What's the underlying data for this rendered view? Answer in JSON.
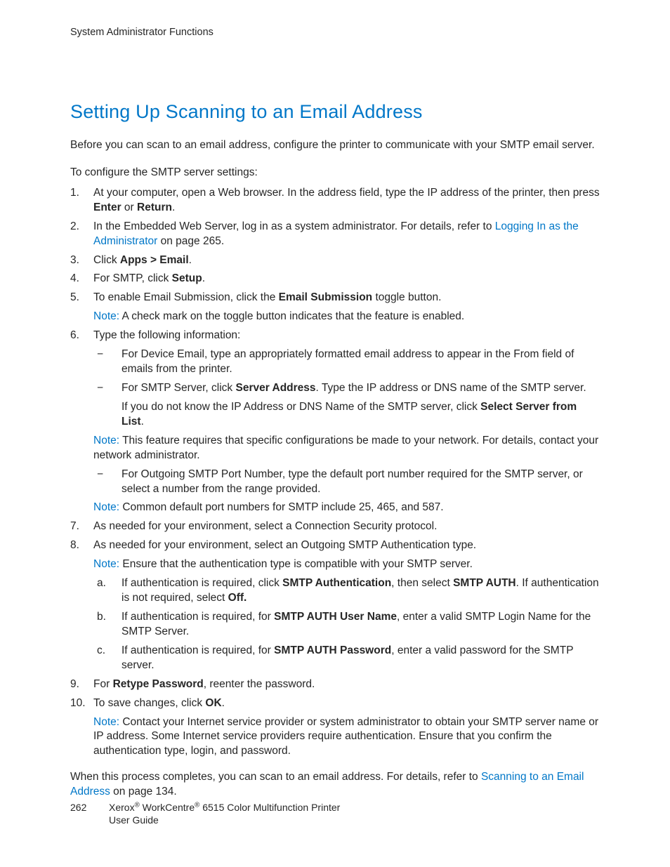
{
  "header": "System Administrator Functions",
  "title": "Setting Up Scanning to an Email Address",
  "intro": "Before you can scan to an email address, configure the printer to communicate with your SMTP email server.",
  "lead": "To configure the SMTP server settings:",
  "steps": {
    "s1a": "At your computer, open a Web browser. In the address field, type the IP address of the printer, then press ",
    "s1b": "Enter",
    "s1c": " or ",
    "s1d": "Return",
    "s1e": ".",
    "s2a": "In the Embedded Web Server, log in as a system administrator. For details, refer to ",
    "s2link": "Logging In as the Administrator",
    "s2b": " on page 265.",
    "s3a": "Click ",
    "s3b": "Apps > Email",
    "s3c": ".",
    "s4a": "For SMTP, click ",
    "s4b": "Setup",
    "s4c": ".",
    "s5a": "To enable Email Submission, click the ",
    "s5b": "Email Submission",
    "s5c": " toggle button.",
    "note5": "A check mark on the toggle button indicates that the feature is enabled.",
    "s6": "Type the following information:",
    "s6d1": "For Device Email, type an appropriately formatted email address to appear in the From field of emails from the printer.",
    "s6d2a": "For SMTP Server, click ",
    "s6d2b": "Server Address",
    "s6d2c": ". Type the IP address or DNS name of the SMTP server.",
    "s6d2xa": "If you do not know the IP Address or DNS Name of the SMTP server, click ",
    "s6d2xb": "Select Server from List",
    "s6d2xc": ".",
    "note6a": "This feature requires that specific configurations be made to your network. For details, contact your network administrator.",
    "s6d3": "For Outgoing SMTP Port Number, type the default port number required for the SMTP server, or select a number from the range provided.",
    "note6b": "Common default port numbers for SMTP include 25, 465, and 587.",
    "s7": "As needed for your environment, select a Connection Security protocol.",
    "s8": "As needed for your environment, select an Outgoing SMTP Authentication type.",
    "note8": "Ensure that the authentication type is compatible with your SMTP server.",
    "s8a1": "If authentication is required, click ",
    "s8a2": "SMTP Authentication",
    "s8a3": ", then select ",
    "s8a4": "SMTP AUTH",
    "s8a5": ". If authentication is not required, select ",
    "s8a6": "Off.",
    "s8b1": "If authentication is required, for ",
    "s8b2": "SMTP AUTH User Name",
    "s8b3": ", enter a valid SMTP Login Name for the SMTP Server.",
    "s8c1": "If authentication is required, for ",
    "s8c2": "SMTP AUTH Password",
    "s8c3": ", enter a valid password for the SMTP server.",
    "s9a": "For ",
    "s9b": "Retype Password",
    "s9c": ", reenter the password.",
    "s10a": "To save changes, click ",
    "s10b": "OK",
    "s10c": ".",
    "note10": "Contact your Internet service provider or system administrator to obtain your SMTP server name or IP address. Some Internet service providers require authentication. Ensure that you confirm the authentication type, login, and password."
  },
  "noteLabel": "Note: ",
  "closingA": "When this process completes, you can scan to an email address. For details, refer to ",
  "closingLink": "Scanning to an Email Address",
  "closingB": " on page 134.",
  "footer": {
    "page": "262",
    "line1": "Xerox® WorkCentre® 6515 Color Multifunction Printer",
    "line2": "User Guide"
  }
}
